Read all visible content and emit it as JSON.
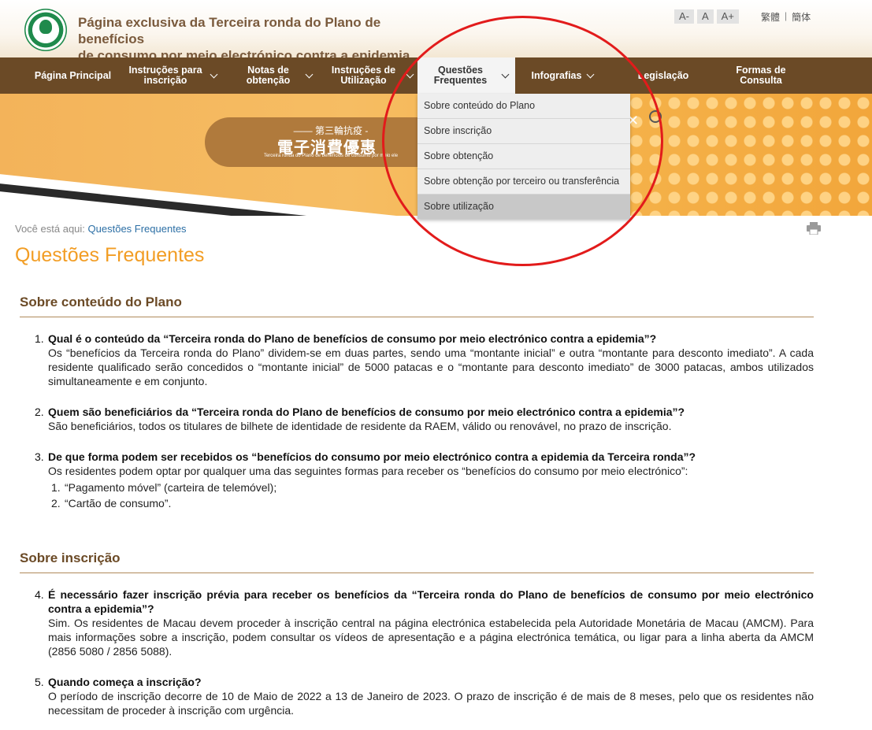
{
  "header": {
    "title_line1": "Página exclusiva da Terceira ronda do Plano de benefícios",
    "title_line2": "de consumo por meio electrónico contra a epidemia",
    "font_buttons": [
      "A-",
      "A",
      "A+"
    ],
    "lang_trad": "繁體",
    "lang_sep": "|",
    "lang_simp": "簡体"
  },
  "nav": {
    "items": [
      {
        "label": "Página Principal"
      },
      {
        "label": "Instruções para inscrição"
      },
      {
        "label": "Notas de obtenção"
      },
      {
        "label": "Instruções de Utilização"
      },
      {
        "label": "Questões Frequentes"
      },
      {
        "label": "Infografias"
      },
      {
        "label": "Legislação"
      },
      {
        "label": "Formas de Consulta"
      }
    ]
  },
  "dropdown": {
    "items": [
      "Sobre conteúdo do Plano",
      "Sobre inscrição",
      "Sobre obtenção",
      "Sobre obtenção por terceiro ou transferência",
      "Sobre utilização"
    ]
  },
  "banner": {
    "sub": "—— 第三輪抗疫 -",
    "main": "電子消費優惠",
    "tiny": "Terceira ronda do Plano de benefícios de consumo por meio ele"
  },
  "breadcrumb": {
    "prefix": "Você está aqui:",
    "current": "Questões Frequentes"
  },
  "page_title": "Questões Frequentes",
  "sections": [
    {
      "title": "Sobre conteúdo do Plano",
      "faqs": [
        {
          "num": "1.",
          "q": "Qual é o conteúdo da “Terceira ronda do Plano de benefícios de consumo por meio electrónico contra a epidemia”?",
          "a": "Os “benefícios da Terceira ronda do Plano” dividem-se em duas partes, sendo uma “montante inicial” e outra “montante para desconto imediato”. A cada residente qualificado serão concedidos o “montante inicial” de 5000 patacas e o “montante para desconto imediato” de 3000 patacas, ambos utilizados simultaneamente e em conjunto."
        },
        {
          "num": "2.",
          "q": "Quem são beneficiários da “Terceira ronda do Plano de benefícios de consumo por meio electrónico contra a epidemia”?",
          "a": "São beneficiários, todos os titulares de bilhete de identidade de residente da RAEM, válido ou renovável, no prazo de inscrição."
        },
        {
          "num": "3.",
          "q": "De que forma podem ser recebidos os “benefícios do consumo por meio electrónico contra a epidemia da Terceira ronda”?",
          "a": "Os residentes podem optar por qualquer uma das seguintes formas para receber os “benefícios do consumo por meio electrónico”:",
          "sub": [
            {
              "n": "1.",
              "t": "“Pagamento móvel” (carteira de telemóvel);"
            },
            {
              "n": "2.",
              "t": "“Cartão de consumo”."
            }
          ]
        }
      ]
    },
    {
      "title": "Sobre inscrição",
      "faqs": [
        {
          "num": "4.",
          "q": "É necessário fazer inscrição prévia para receber os benefícios da “Terceira ronda do Plano de benefícios de consumo por meio electrónico contra a epidemia”?",
          "a": "Sim. Os residentes de Macau devem proceder à inscrição central na página electrónica estabelecida pela Autoridade Monetária de Macau (AMCM). Para mais informações sobre a inscrição, podem consultar os vídeos de apresentação e a página electrónica temática, ou ligar para a linha aberta da AMCM (2856 5080 / 2856 5088)."
        },
        {
          "num": "5.",
          "q": "Quando começa a inscrição?",
          "a": "O período de inscrição decorre de 10 de Maio de 2022 a 13 de Janeiro de 2023. O prazo de inscrição é de mais de 8 meses, pelo que os residentes não necessitam de proceder à inscrição com urgência."
        }
      ]
    }
  ],
  "colors": {
    "nav_bg": "#6b4a26",
    "title_orange": "#f29d24",
    "section_brown": "#6b4a26",
    "annotation_red": "#e21b1b"
  }
}
